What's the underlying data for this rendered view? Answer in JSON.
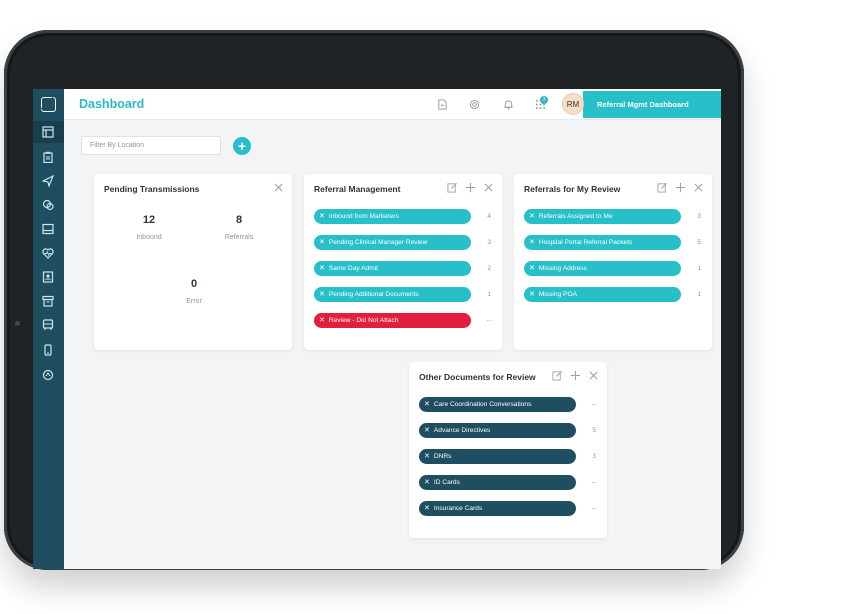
{
  "header": {
    "title": "Dashboard",
    "notification_count": "3",
    "avatar_initials": "RM",
    "brand_label": "Referral Mgmt Dashboard"
  },
  "filter": {
    "placeholder": "Filter By Location",
    "add_label": "+"
  },
  "icons": {
    "sidebar": [
      "grid-icon",
      "clipboard-icon",
      "send-icon",
      "chat-icon",
      "inbox-icon",
      "heart-pulse-icon",
      "contacts-icon",
      "archive-icon",
      "bus-icon",
      "phone-icon",
      "circle-arrows-icon"
    ],
    "topbar": [
      "file-icon",
      "settings-icon",
      "bell-icon",
      "apps-grid-icon"
    ]
  },
  "pending": {
    "title": "Pending Transmissions",
    "inbound_value": "12",
    "inbound_label": "Inbound",
    "referrals_value": "8",
    "referrals_label": "Referrals",
    "error_value": "0",
    "error_label": "Error"
  },
  "referral_mgmt": {
    "title": "Referral Management",
    "items": [
      {
        "label": "Inbound from Marketers",
        "count": "4"
      },
      {
        "label": "Pending Clinical Manager Review",
        "count": "3"
      },
      {
        "label": "Same Day Admit",
        "count": "2"
      },
      {
        "label": "Pending Additional Documents",
        "count": "1"
      },
      {
        "label": "Review - Did Not Attach",
        "count": "--"
      }
    ]
  },
  "my_review": {
    "title": "Referrals for My Review",
    "items": [
      {
        "label": "Referrals Assigned to Me",
        "count": "3"
      },
      {
        "label": "Hospital Portal Referral Packets",
        "count": "5"
      },
      {
        "label": "Missing Address",
        "count": "1"
      },
      {
        "label": "Missing POA",
        "count": "1"
      }
    ]
  },
  "other_docs": {
    "title": "Other Documents for Review",
    "items": [
      {
        "label": "Care Coordination Conversations",
        "count": "--"
      },
      {
        "label": "Advance Directives",
        "count": "5"
      },
      {
        "label": "DNRs",
        "count": "3"
      },
      {
        "label": "ID Cards",
        "count": "--"
      },
      {
        "label": "Insurance Cards",
        "count": "--"
      }
    ]
  },
  "colors": {
    "accent": "#27c0c8",
    "navy": "#1e4e5f",
    "alert": "#e41f3e"
  }
}
